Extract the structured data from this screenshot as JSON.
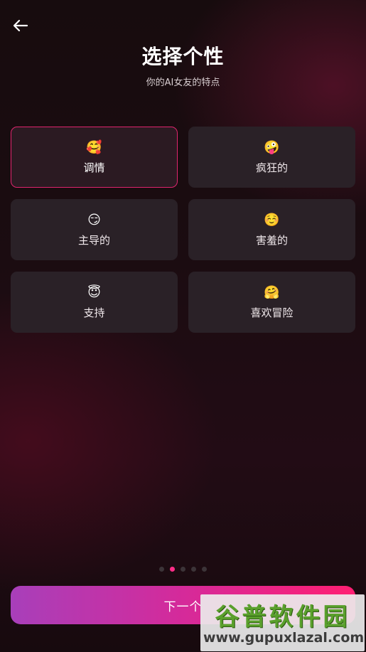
{
  "header": {
    "back_icon": "arrow-left-icon",
    "title": "选择个性",
    "subtitle": "你的AI女友的特点"
  },
  "personalities": [
    {
      "emoji": "🥰",
      "label": "调情",
      "selected": true
    },
    {
      "emoji": "🤪",
      "label": "疯狂的",
      "selected": false
    },
    {
      "emoji": "😏",
      "label": "主导的",
      "selected": false
    },
    {
      "emoji": "☺️",
      "label": "害羞的",
      "selected": false
    },
    {
      "emoji": "😇",
      "label": "支持",
      "selected": false
    },
    {
      "emoji": "🤗",
      "label": "喜欢冒险",
      "selected": false
    }
  ],
  "pagination": {
    "total": 5,
    "current": 2
  },
  "footer": {
    "next_label": "下一个"
  },
  "watermark": {
    "logo_text": "谷普软件园",
    "url": "www.gupuxlazal.com"
  },
  "colors": {
    "accent": "#ff2d88",
    "selected_border": "#e0256e",
    "button_start": "#a83fba",
    "button_end": "#ff1f72"
  }
}
